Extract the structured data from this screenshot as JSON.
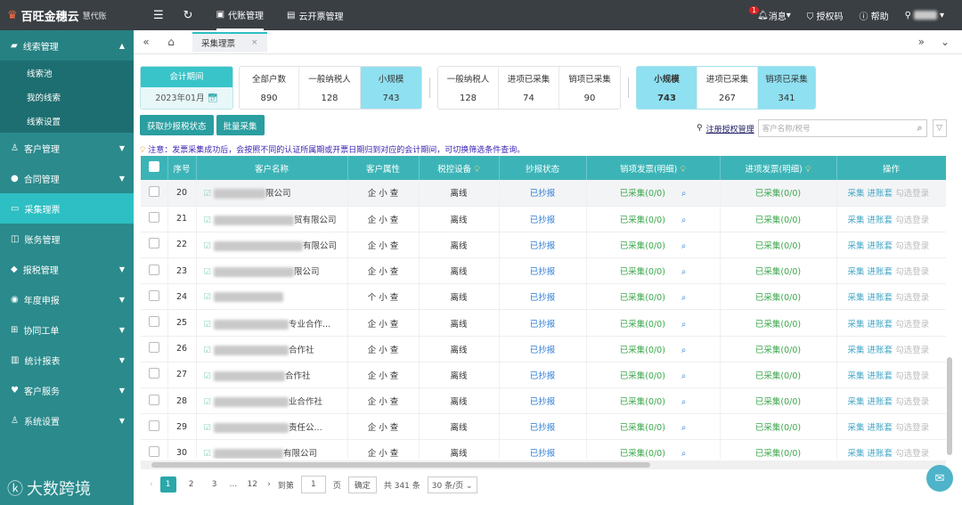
{
  "topbar": {
    "brand": "百旺金穗云",
    "brand_sub": "慧代账",
    "nav": [
      {
        "label": "代账管理",
        "icon": "briefcase-icon"
      },
      {
        "label": "云开票管理",
        "icon": "invoice-icon"
      }
    ],
    "message": "消息",
    "message_badge": "1",
    "auth": "授权码",
    "help": "帮助"
  },
  "sidebar": {
    "items": [
      {
        "label": "线索管理",
        "icon": "clue-icon",
        "state": "open"
      },
      {
        "label": "客户管理",
        "icon": "customer-icon"
      },
      {
        "label": "合同管理",
        "icon": "contract-icon"
      },
      {
        "label": "采集理票",
        "icon": "collect-icon",
        "state": "active"
      },
      {
        "label": "账务管理",
        "icon": "account-icon"
      },
      {
        "label": "报税管理",
        "icon": "tax-icon"
      },
      {
        "label": "年度申报",
        "icon": "annual-icon"
      },
      {
        "label": "协同工单",
        "icon": "ticket-icon"
      },
      {
        "label": "统计报表",
        "icon": "report-icon"
      },
      {
        "label": "客户服务",
        "icon": "service-icon"
      },
      {
        "label": "系统设置",
        "icon": "settings-icon"
      }
    ],
    "subitems": [
      "线索池",
      "我的线索",
      "线索设置"
    ],
    "footer": "大数跨境"
  },
  "tabs": {
    "active": "采集理票"
  },
  "period": {
    "label": "会计期间",
    "value": "2023年01月"
  },
  "stats1": [
    {
      "label": "全部户数",
      "value": "890"
    },
    {
      "label": "一般纳税人",
      "value": "128"
    },
    {
      "label": "小规模",
      "value": "743"
    }
  ],
  "stats2": [
    {
      "label": "一般纳税人",
      "value": "128"
    },
    {
      "label": "进项已采集",
      "value": "74"
    },
    {
      "label": "销项已采集",
      "value": "90"
    }
  ],
  "stats3": [
    {
      "label": "小规模",
      "value": "743"
    },
    {
      "label": "进项已采集",
      "value": "267"
    },
    {
      "label": "销项已采集",
      "value": "341"
    }
  ],
  "buttons": {
    "fetch": "获取抄报税状态",
    "batch": "批量采集"
  },
  "register_link": "注册授权管理",
  "search_placeholder": "客户名称/税号",
  "notice": "注意：发票采集成功后，会按照不同的认证所属期或开票日期归到对应的会计期间，可切换筛选条件查询。",
  "table": {
    "headers": [
      "序号",
      "客户名称",
      "客户属性",
      "税控设备",
      "抄报状态",
      "销项发票(明细)",
      "进项发票(明细)",
      "操作"
    ],
    "rows": [
      {
        "no": "20",
        "name": "限公司",
        "attr": "企 小 查",
        "device": "离线",
        "status": "已抄报",
        "sales": "已采集(0/0)",
        "purchase": "已采集(0/0)"
      },
      {
        "no": "21",
        "name": "贸有限公司",
        "attr": "企 小 查",
        "device": "离线",
        "status": "已抄报",
        "sales": "已采集(0/0)",
        "purchase": "已采集(0/0)"
      },
      {
        "no": "22",
        "name": "有限公司",
        "attr": "企 小 查",
        "device": "离线",
        "status": "已抄报",
        "sales": "已采集(0/0)",
        "purchase": "已采集(0/0)"
      },
      {
        "no": "23",
        "name": "限公司",
        "attr": "企 小 查",
        "device": "离线",
        "status": "已抄报",
        "sales": "已采集(0/0)",
        "purchase": "已采集(0/0)"
      },
      {
        "no": "24",
        "name": "",
        "attr": "个 小 查",
        "device": "离线",
        "status": "已抄报",
        "sales": "已采集(0/0)",
        "purchase": "已采集(0/0)"
      },
      {
        "no": "25",
        "name": "专业合作...",
        "attr": "企 小 查",
        "device": "离线",
        "status": "已抄报",
        "sales": "已采集(0/0)",
        "purchase": "已采集(0/0)"
      },
      {
        "no": "26",
        "name": "合作社",
        "attr": "企 小 查",
        "device": "离线",
        "status": "已抄报",
        "sales": "已采集(0/0)",
        "purchase": "已采集(0/0)"
      },
      {
        "no": "27",
        "name": "合作社",
        "attr": "企 小 查",
        "device": "离线",
        "status": "已抄报",
        "sales": "已采集(0/0)",
        "purchase": "已采集(0/0)"
      },
      {
        "no": "28",
        "name": "业合作社",
        "attr": "企 小 查",
        "device": "离线",
        "status": "已抄报",
        "sales": "已采集(0/0)",
        "purchase": "已采集(0/0)"
      },
      {
        "no": "29",
        "name": "责任公...",
        "attr": "企 小 查",
        "device": "离线",
        "status": "已抄报",
        "sales": "已采集(0/0)",
        "purchase": "已采集(0/0)"
      },
      {
        "no": "30",
        "name": "有限公司",
        "attr": "企 小 查",
        "device": "离线",
        "status": "已抄报",
        "sales": "已采集(0/0)",
        "purchase": "已采集(0/0)"
      }
    ],
    "ops": [
      "采集",
      "进账套",
      "勾选登录"
    ]
  },
  "pager": {
    "pages": [
      "1",
      "2",
      "3",
      "...",
      "12"
    ],
    "goto": "到第",
    "input": "1",
    "page_unit": "页",
    "confirm": "确定",
    "total": "共 341 条",
    "per_page": "30 条/页"
  },
  "colors": {
    "sidebar": "#2a8a8c",
    "active": "#2dbfc3",
    "header": "#3cb4b7",
    "topbar": "#3a3f44"
  }
}
